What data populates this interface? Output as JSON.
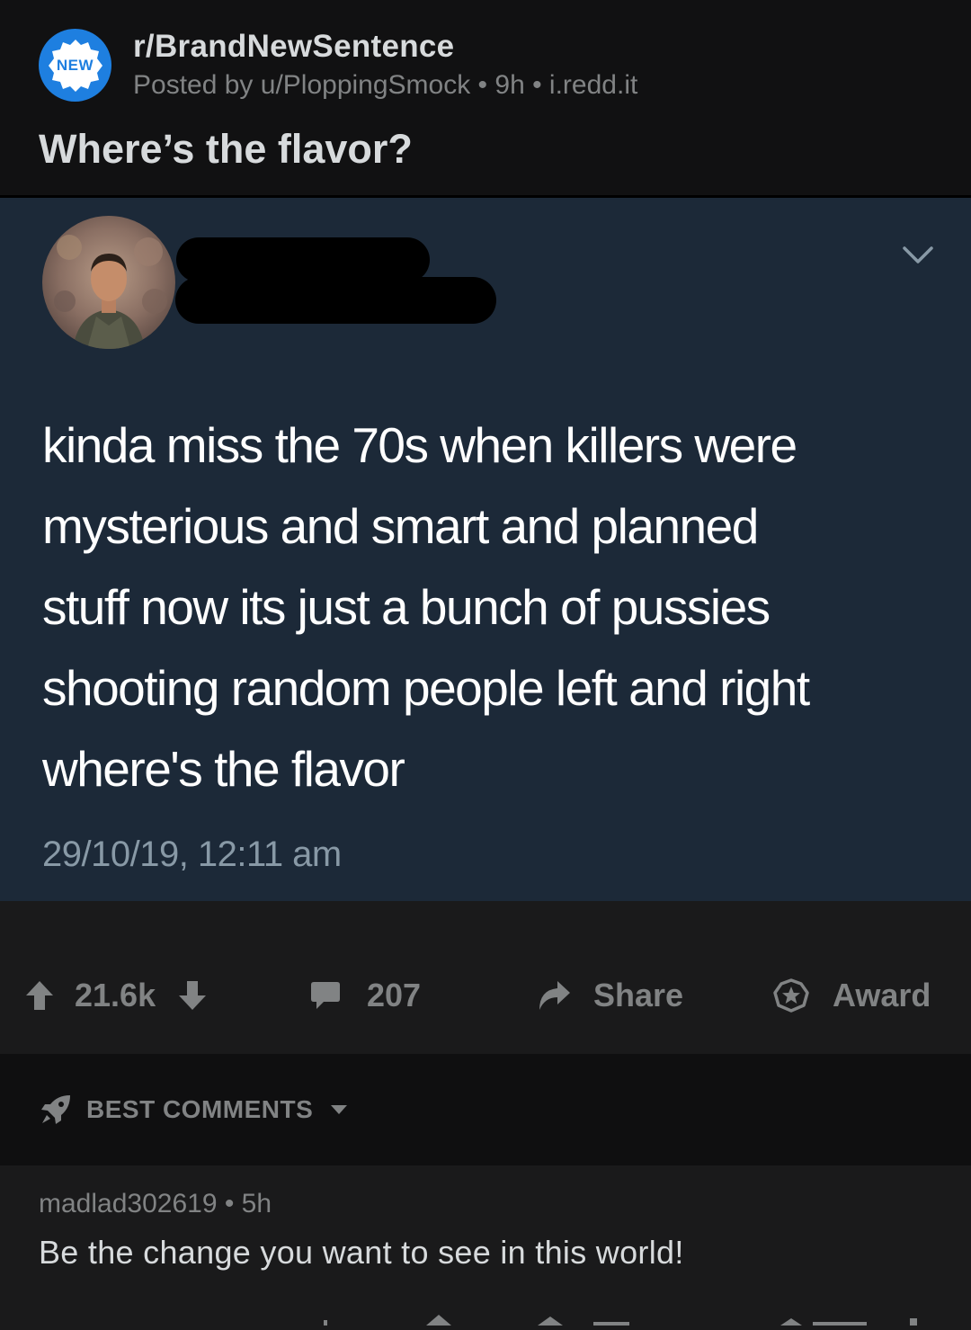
{
  "subreddit": {
    "name": "r/BrandNewSentence",
    "icon_badge": "NEW",
    "icon_color": "#1e7fe0"
  },
  "post": {
    "meta": "Posted by u/PloppingSmock • 9h • i.redd.it",
    "title": "Where’s the flavor?"
  },
  "tweet": {
    "text": "kinda miss the 70s when killers were\nmysterious and smart and planned\nstuff now its just a bunch of pussies\nshooting random people left and right\nwhere's the flavor",
    "timestamp": "29/10/19, 12:11 am",
    "bg_color": "#1c2938"
  },
  "actions": {
    "votes": "21.6k",
    "comments": "207",
    "share": "Share",
    "award": "Award"
  },
  "sort": {
    "label": "BEST COMMENTS"
  },
  "comment": {
    "meta": "madlad302619 • 5h",
    "body": "Be the change you want to see in this world!"
  },
  "icons": [
    "new-badge-icon",
    "chevron-down-icon",
    "upvote-icon",
    "downvote-icon",
    "comment-icon",
    "share-icon",
    "award-icon",
    "rocket-icon",
    "caret-down-icon"
  ]
}
